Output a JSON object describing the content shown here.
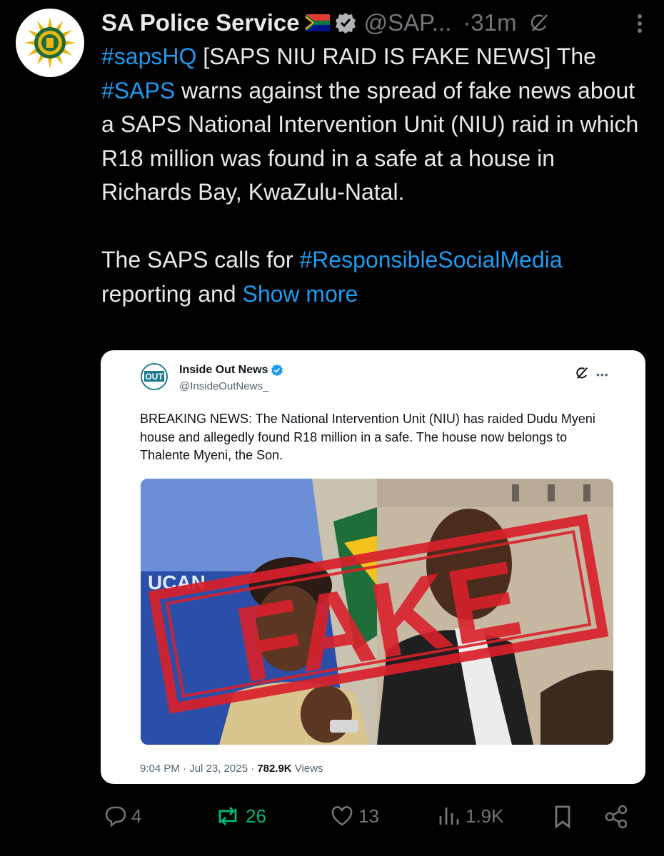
{
  "post": {
    "author_name": "SA Police Service",
    "author_handle": "@SAP...",
    "time": "·31m",
    "text": {
      "p1_tag1": "#sapsHQ",
      "p1_rest1": " [SAPS NIU RAID IS FAKE NEWS] The ",
      "p1_tag2": "#SAPS",
      "p1_rest2": " warns against the spread of fake news about a SAPS National  Intervention Unit (NIU) raid in which R18 million was found in a safe at  a house in Richards Bay, KwaZulu-Natal.",
      "p2_start": "The SAPS calls for ",
      "p2_tag": "#ResponsibleSocialMedia",
      "p2_rest": " reporting and ",
      "show_more": "Show more"
    }
  },
  "quoted": {
    "author_name": "Inside Out News",
    "author_handle": "@InsideOutNews_",
    "avatar_text": "OUT",
    "text": "BREAKING NEWS: The National Intervention Unit (NIU) has raided Dudu Myeni house and  allegedly found R18 million in a safe. The house now belongs to Thalente Myeni, the Son.",
    "stamp": "FAKE",
    "time": "9:04 PM · Jul 23, 2025 · ",
    "views_count": "782.9K",
    "views_label": " Views",
    "bg_text": "UCAN"
  },
  "actions": {
    "replies": "4",
    "reposts": "26",
    "likes": "13",
    "views": "1.9K"
  },
  "colors": {
    "background": "#000000",
    "link": "#1d9bf0",
    "repost": "#00ba7c",
    "stamp": "#d8202a"
  }
}
